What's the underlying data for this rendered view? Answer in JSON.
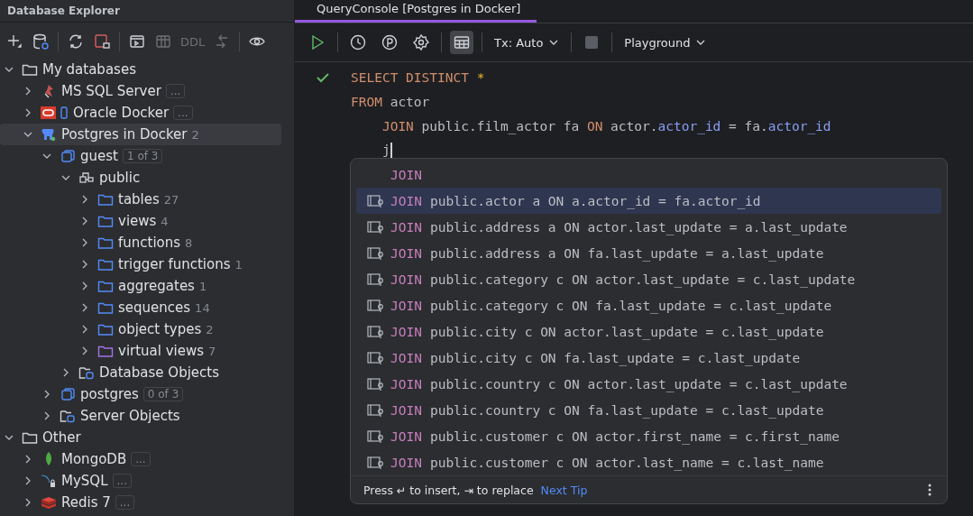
{
  "panel_title": "Database Explorer",
  "explorer_toolbar": [
    {
      "kind": "add",
      "disabled": false
    },
    {
      "kind": "db-settings",
      "disabled": false
    },
    {
      "kind": "refresh",
      "disabled": false
    },
    {
      "kind": "disconnect",
      "disabled": false
    },
    {
      "kind": "console",
      "disabled": false
    },
    {
      "kind": "table",
      "disabled": true
    },
    {
      "kind": "text",
      "label": "DDL",
      "disabled": true
    },
    {
      "kind": "jump",
      "disabled": true
    },
    {
      "kind": "eye",
      "disabled": false
    }
  ],
  "tree": [
    {
      "label": "My databases",
      "kind": "folder",
      "expanded": true,
      "selected": false,
      "children": [
        {
          "label": "MS SQL Server",
          "kind": "mssql",
          "badge": "...",
          "expanded": false,
          "selected": false
        },
        {
          "label": "Oracle Docker",
          "kind": "oracle",
          "badge": "...",
          "expanded": false,
          "selected": false
        },
        {
          "label": "Postgres in Docker",
          "kind": "postgres",
          "count": "2",
          "expanded": true,
          "selected": true,
          "children": [
            {
              "label": "guest",
              "kind": "schema-set",
              "badge": "1 of 3",
              "expanded": true,
              "selected": false,
              "children": [
                {
                  "label": "public",
                  "kind": "schema",
                  "expanded": true,
                  "selected": false,
                  "children": [
                    {
                      "label": "tables",
                      "kind": "folder-blue",
                      "count": "27",
                      "expanded": false,
                      "selected": false
                    },
                    {
                      "label": "views",
                      "kind": "folder-blue",
                      "count": "4",
                      "expanded": false,
                      "selected": false
                    },
                    {
                      "label": "functions",
                      "kind": "folder-blue",
                      "count": "8",
                      "expanded": false,
                      "selected": false
                    },
                    {
                      "label": "trigger functions",
                      "kind": "folder-blue",
                      "count": "1",
                      "expanded": false,
                      "selected": false
                    },
                    {
                      "label": "aggregates",
                      "kind": "folder-blue",
                      "count": "1",
                      "expanded": false,
                      "selected": false
                    },
                    {
                      "label": "sequences",
                      "kind": "folder-blue",
                      "count": "14",
                      "expanded": false,
                      "selected": false
                    },
                    {
                      "label": "object types",
                      "kind": "folder-blue",
                      "count": "2",
                      "expanded": false,
                      "selected": false
                    },
                    {
                      "label": "virtual views",
                      "kind": "folder-purple",
                      "count": "7",
                      "expanded": false,
                      "selected": false
                    }
                  ]
                },
                {
                  "label": "Database Objects",
                  "kind": "objects",
                  "expanded": false,
                  "selected": false
                }
              ]
            },
            {
              "label": "postgres",
              "kind": "schema-set",
              "badge": "0 of 3",
              "expanded": false,
              "selected": false
            },
            {
              "label": "Server Objects",
              "kind": "objects",
              "expanded": false,
              "selected": false
            }
          ]
        }
      ]
    },
    {
      "label": "Other",
      "kind": "folder",
      "expanded": true,
      "selected": false,
      "children": [
        {
          "label": "MongoDB",
          "kind": "mongo",
          "badge": "...",
          "expanded": false,
          "selected": false
        },
        {
          "label": "MySQL",
          "kind": "mysql",
          "badge": "...",
          "expanded": false,
          "selected": false
        },
        {
          "label": "Redis 7",
          "kind": "redis",
          "badge": "...",
          "expanded": false,
          "selected": false
        }
      ]
    }
  ],
  "editor_tab": {
    "title": "QueryConsole [Postgres in Docker]",
    "selected": true
  },
  "editor_toolbar": [
    {
      "kind": "run"
    },
    {
      "kind": "sep"
    },
    {
      "kind": "history"
    },
    {
      "kind": "params"
    },
    {
      "kind": "settings"
    },
    {
      "kind": "sep"
    },
    {
      "kind": "grid",
      "selected": true
    },
    {
      "kind": "sep"
    },
    {
      "kind": "dropdown",
      "label": "Tx: Auto"
    },
    {
      "kind": "sep"
    },
    {
      "kind": "stop"
    },
    {
      "kind": "sep"
    },
    {
      "kind": "dropdown",
      "label": "Playground"
    }
  ],
  "code": [
    {
      "checked": true,
      "tokens": [
        {
          "text": "SELECT DISTINCT ",
          "kind": "keyword"
        },
        {
          "text": "*",
          "kind": "star"
        }
      ]
    },
    {
      "checked": false,
      "tokens": [
        {
          "text": "FROM ",
          "kind": "keyword"
        },
        {
          "text": "actor",
          "kind": "plain"
        }
      ]
    },
    {
      "checked": false,
      "tokens": [
        {
          "text": "    JOIN ",
          "kind": "keyword"
        },
        {
          "text": "public.film_actor fa ",
          "kind": "plain"
        },
        {
          "text": "ON ",
          "kind": "keyword"
        },
        {
          "text": "actor.",
          "kind": "plain"
        },
        {
          "text": "actor_id",
          "kind": "field"
        },
        {
          "text": " = fa.",
          "kind": "plain"
        },
        {
          "text": "actor_id",
          "kind": "field"
        }
      ]
    },
    {
      "checked": false,
      "caret": true,
      "tokens": [
        {
          "text": "    j",
          "kind": "plain"
        }
      ]
    }
  ],
  "completion": {
    "items": [
      {
        "kind": "keyword",
        "keyword": "JOIN",
        "selected": false
      },
      {
        "kind": "join",
        "keyword": "JOIN",
        "text": "public.actor a ON a.actor_id = fa.actor_id",
        "selected": true
      },
      {
        "kind": "join",
        "keyword": "JOIN",
        "text": "public.address a ON actor.last_update = a.last_update",
        "selected": false
      },
      {
        "kind": "join",
        "keyword": "JOIN",
        "text": "public.address a ON fa.last_update = a.last_update",
        "selected": false
      },
      {
        "kind": "join",
        "keyword": "JOIN",
        "text": "public.category c ON actor.last_update = c.last_update",
        "selected": false
      },
      {
        "kind": "join",
        "keyword": "JOIN",
        "text": "public.category c ON fa.last_update = c.last_update",
        "selected": false
      },
      {
        "kind": "join",
        "keyword": "JOIN",
        "text": "public.city c ON actor.last_update = c.last_update",
        "selected": false
      },
      {
        "kind": "join",
        "keyword": "JOIN",
        "text": "public.city c ON fa.last_update = c.last_update",
        "selected": false
      },
      {
        "kind": "join",
        "keyword": "JOIN",
        "text": "public.country c ON actor.last_update = c.last_update",
        "selected": false
      },
      {
        "kind": "join",
        "keyword": "JOIN",
        "text": "public.country c ON fa.last_update = c.last_update",
        "selected": false
      },
      {
        "kind": "join",
        "keyword": "JOIN",
        "text": "public.customer c ON actor.first_name = c.first_name",
        "selected": false
      },
      {
        "kind": "join",
        "keyword": "JOIN",
        "text": "public.customer c ON actor.last_name = c.last_name",
        "selected": false
      }
    ],
    "hint": "Press ↵ to insert, ⇥ to replace",
    "link": "Next Tip"
  }
}
